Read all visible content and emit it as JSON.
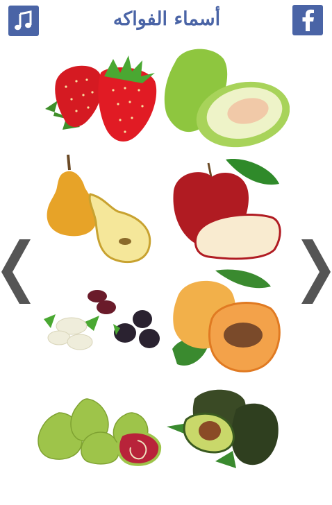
{
  "header": {
    "title": "أسماء الفواكه",
    "music_icon": "music-note-icon",
    "facebook_icon": "facebook-icon"
  },
  "navigation": {
    "prev_icon": "chevron-left-icon",
    "next_icon": "chevron-right-icon"
  },
  "fruits": [
    {
      "id": "strawberry"
    },
    {
      "id": "guava"
    },
    {
      "id": "pear"
    },
    {
      "id": "apple"
    },
    {
      "id": "mulberry"
    },
    {
      "id": "apricot"
    },
    {
      "id": "fig"
    },
    {
      "id": "avocado"
    }
  ],
  "colors": {
    "brand": "#4a64a6",
    "nav_arrow": "#555555"
  }
}
